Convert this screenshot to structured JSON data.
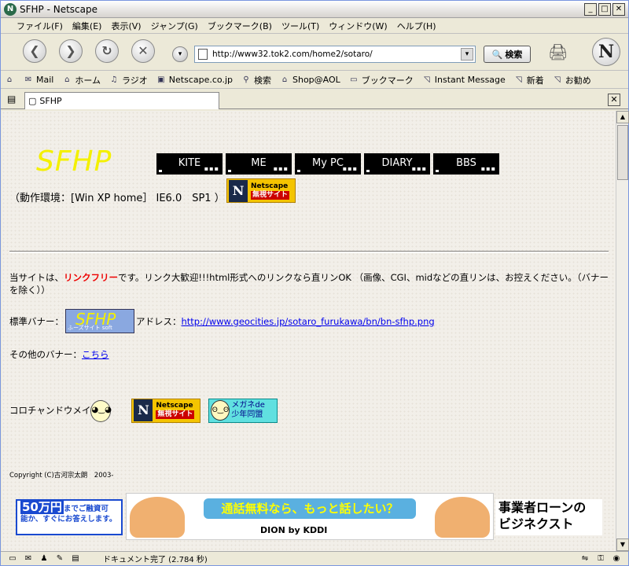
{
  "window": {
    "title": "SFHP - Netscape",
    "app_icon": "N",
    "min": "_",
    "max": "□",
    "close": "✕"
  },
  "menubar": {
    "items": [
      "ファイル(F)",
      "編集(E)",
      "表示(V)",
      "ジャンプ(G)",
      "ブックマーク(B)",
      "ツール(T)",
      "ウィンドウ(W)",
      "ヘルプ(H)"
    ]
  },
  "navbar": {
    "url": "http://www32.tok2.com/home2/sotaro/",
    "search_label": "検索"
  },
  "personalbar": {
    "items": [
      "Mail",
      "ホーム",
      "ラジオ",
      "Netscape.co.jp",
      "検索",
      "Shop@AOL",
      "ブックマーク",
      "Instant Message",
      "新着",
      "お勧め"
    ]
  },
  "tab": {
    "label": "SFHP"
  },
  "page": {
    "logo": "SFHP",
    "nav": [
      "KITE",
      "ME",
      "My PC",
      "DIARY",
      "BBS"
    ],
    "env": "（動作環境：[Win XP home］ IE6.0　SP1 ）",
    "ns_banner": {
      "line1": "Netscape",
      "line2": "無視サイト"
    },
    "para_before": "当サイトは、",
    "para_red": "リンクフリー",
    "para_after": "です。リンク大歓迎!!!html形式へのリンクなら直リンOK （画像、CGI、midなどの直リンは、お控えください。（バナーを除く））",
    "std_banner_label": "標準バナー：",
    "std_banner_logo": "SFHP",
    "std_banner_sub": "ふーズサイト soft",
    "address_label": "アドレス：",
    "address_link": "http://www.geocities.jp/sotaro_furukawa/bn/bn-sfhp.png",
    "other_label": "その他のバナー：",
    "other_link": "こちら",
    "koro": "コロチャンドウメイ",
    "megane": {
      "line1": "メガネde",
      "line2": "少年同盟"
    },
    "copyright": "Copyright (C)古河宗太朗　2003-"
  },
  "ads": {
    "ad1_big": "50万円",
    "ad1_line1": "までご融資可",
    "ad1_line2": "能か、すぐにお答えします。",
    "ad2_head": "通話無料なら、もっと話したい？",
    "ad2_brand": "DION by KDDI",
    "ad3_line1": "事業者ローンの",
    "ad3_line2": "ビジネクスト"
  },
  "status": {
    "text": "ドキュメント完了 (2.784 秒)"
  }
}
